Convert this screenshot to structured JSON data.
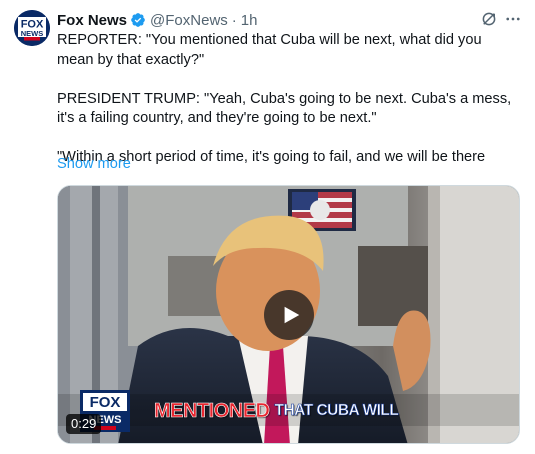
{
  "author": {
    "name": "Fox News",
    "handle": "@FoxNews",
    "separator": "·",
    "time": "1h",
    "avatar_text": "FOX NEWS channel"
  },
  "tweet": {
    "paragraphs": [
      "REPORTER: \"You mentioned that Cuba will be next, what did you mean by that exactly?\"",
      "PRESIDENT TRUMP: \"Yeah, Cuba's going to be next. Cuba's a mess, it's a failing country, and they're going to be next.\"",
      "\"Within a short period of time, it's going to fail, and we will be there"
    ],
    "show_more": "Show more"
  },
  "media": {
    "duration": "0:29",
    "chyron_highlight": "MENTIONED",
    "chyron_rest": "THAT CUBA WILL",
    "bug_text": "FOX NEWS channel"
  },
  "icons": {
    "verified": "verified-badge-icon",
    "grok": "grok-icon",
    "more": "more-icon",
    "play": "play-icon"
  },
  "colors": {
    "accent": "#1d9bf0",
    "secondary_text": "#536471",
    "text": "#0f1419",
    "chyron_red": "#e8262f"
  }
}
